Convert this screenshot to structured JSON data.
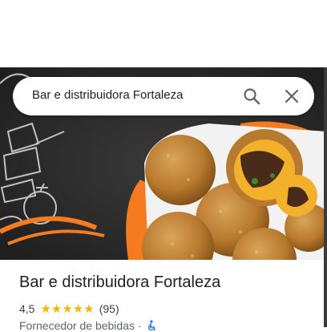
{
  "search": {
    "query": "Bar e distribuidora Fortaleza",
    "search_icon": "search-icon",
    "close_icon": "close-icon"
  },
  "hero_photo": {
    "description_icon": "food-photo",
    "accent_color": "#f47b20"
  },
  "place": {
    "name": "Bar e distribuidora Fortaleza",
    "rating": "4,5",
    "stars": "★★★★★",
    "star_value": 4.5,
    "reviews": "(95)",
    "category": "Fornecedor de bebidas",
    "separator": "·",
    "walk_icon": "accessible-icon"
  },
  "colors": {
    "star": "#f5b400",
    "text": "#202124",
    "secondary": "#5f6368"
  }
}
